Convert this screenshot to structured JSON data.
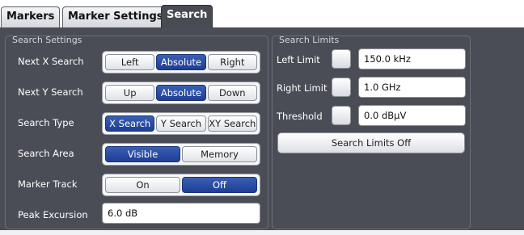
{
  "tabs": [
    {
      "label": "Markers",
      "active": false
    },
    {
      "label": "Marker Settings",
      "active": false
    },
    {
      "label": "Search",
      "active": true
    }
  ],
  "search_settings": {
    "title": "Search Settings",
    "next_x": {
      "label": "Next X Search",
      "options": [
        "Left",
        "Absolute",
        "Right"
      ],
      "selected": "Absolute"
    },
    "next_y": {
      "label": "Next Y Search",
      "options": [
        "Up",
        "Absolute",
        "Down"
      ],
      "selected": "Absolute"
    },
    "search_type": {
      "label": "Search Type",
      "options": [
        "X Search",
        "Y Search",
        "XY Search"
      ],
      "selected": "X Search"
    },
    "search_area": {
      "label": "Search Area",
      "options": [
        "Visible",
        "Memory"
      ],
      "selected": "Visible"
    },
    "marker_track": {
      "label": "Marker Track",
      "options": [
        "On",
        "Off"
      ],
      "selected": "Off"
    },
    "peak_excursion": {
      "label": "Peak Excursion",
      "value": "6.0 dB"
    }
  },
  "search_limits": {
    "title": "Search Limits",
    "left_limit": {
      "label": "Left Limit",
      "checked": false,
      "value": "150.0 kHz"
    },
    "right_limit": {
      "label": "Right Limit",
      "checked": false,
      "value": "1.0 GHz"
    },
    "threshold": {
      "label": "Threshold",
      "checked": false,
      "value": "0.0 dBµV"
    },
    "off_button": "Search Limits Off"
  },
  "colors": {
    "panel_bg": "#4a4d55",
    "selected_button": "#2a4ea6",
    "active_tab": "#484b52"
  }
}
